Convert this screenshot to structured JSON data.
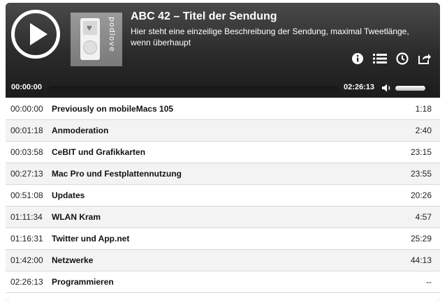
{
  "episode": {
    "title": "ABC 42 – Titel der Sendung",
    "subtitle": "Hier steht eine einzeilige Beschreibung der Sendung, maximal Tweetlänge, wenn überhaupt",
    "cover_logo_text": "podlove"
  },
  "player": {
    "current_time": "00:00:00",
    "duration": "02:26:13",
    "progress": 0.0,
    "volume_level": 0.85,
    "icons": [
      "play-icon",
      "info-icon",
      "chapter-list-icon",
      "clock-icon",
      "share-icon"
    ]
  },
  "chapters": [
    {
      "start": "00:00:00",
      "title": "Previously on mobileMacs 105",
      "duration": "1:18"
    },
    {
      "start": "00:01:18",
      "title": "Anmoderation",
      "duration": "2:40"
    },
    {
      "start": "00:03:58",
      "title": "CeBIT und Grafikkarten",
      "duration": "23:15"
    },
    {
      "start": "00:27:13",
      "title": "Mac Pro und Festplattennutzung",
      "duration": "23:55"
    },
    {
      "start": "00:51:08",
      "title": "Updates",
      "duration": "20:26"
    },
    {
      "start": "01:11:34",
      "title": "WLAN Kram",
      "duration": "4:57"
    },
    {
      "start": "01:16:31",
      "title": "Twitter und App.net",
      "duration": "25:29"
    },
    {
      "start": "01:42:00",
      "title": "Netzwerke",
      "duration": "44:13"
    },
    {
      "start": "02:26:13",
      "title": "Programmieren",
      "duration": "--"
    }
  ]
}
